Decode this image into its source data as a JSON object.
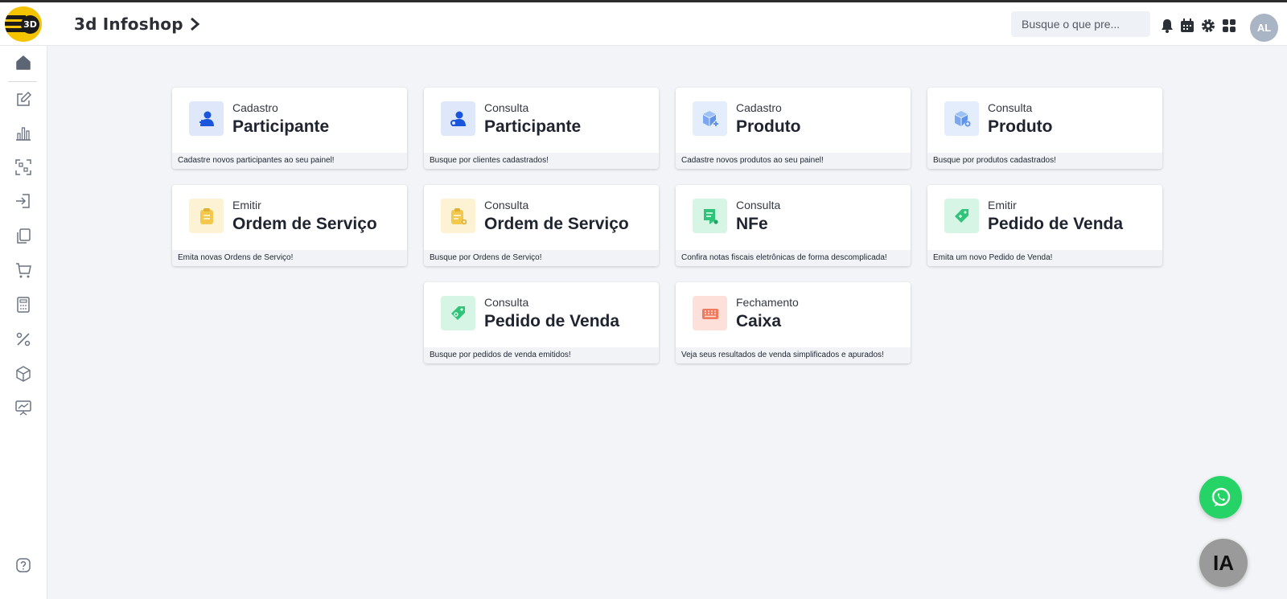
{
  "app": {
    "title": "3d Infoshop",
    "logo_text": "3D",
    "avatar_initials": "AL"
  },
  "search": {
    "placeholder": "Busque o que pre..."
  },
  "header_icons": [
    "bell-icon",
    "calendar-icon",
    "gear-icon",
    "apps-grid-icon"
  ],
  "sidebar": {
    "items": [
      "home-icon",
      "edit-icon",
      "chart-icon",
      "scan-icon",
      "login-icon",
      "copy-icon",
      "cart-icon",
      "calculator-icon",
      "percent-icon",
      "box-icon",
      "presentation-icon",
      "help-icon"
    ]
  },
  "cards": [
    {
      "sub": "Cadastro",
      "title": "Participante",
      "desc": "Cadastre novos participantes ao seu painel!",
      "icon": "user-add-icon",
      "color": "#1a56db",
      "bg": "#dfe7fb"
    },
    {
      "sub": "Consulta",
      "title": "Participante",
      "desc": "Busque por clientes cadastrados!",
      "icon": "user-search-icon",
      "color": "#1a56db",
      "bg": "#dfe7fb"
    },
    {
      "sub": "Cadastro",
      "title": "Produto",
      "desc": "Cadastre novos produtos ao seu painel!",
      "icon": "cube-add-icon",
      "color": "#7aa7f0",
      "bg": "#e3edfc"
    },
    {
      "sub": "Consulta",
      "title": "Produto",
      "desc": "Busque por produtos cadastrados!",
      "icon": "cube-search-icon",
      "color": "#7aa7f0",
      "bg": "#e3edfc"
    },
    {
      "sub": "Emitir",
      "title": "Ordem de Serviço",
      "desc": "Emita novas Ordens de Serviço!",
      "icon": "clipboard-icon",
      "color": "#f2c94c",
      "bg": "#fdf2d3"
    },
    {
      "sub": "Consulta",
      "title": "Ordem de Serviço",
      "desc": "Busque por Ordens de Serviço!",
      "icon": "clipboard-search-icon",
      "color": "#f2c94c",
      "bg": "#fdf2d3"
    },
    {
      "sub": "Consulta",
      "title": "NFe",
      "desc": "Confira notas fiscais eletrônicas de forma descomplicada!",
      "icon": "invoice-icon",
      "color": "#2fc47a",
      "bg": "#d6f5e4"
    },
    {
      "sub": "Emitir",
      "title": "Pedido de Venda",
      "desc": "Emita um novo Pedido de Venda!",
      "icon": "tag-add-icon",
      "color": "#2fc47a",
      "bg": "#d6f5e4"
    },
    {
      "sub": "Consulta",
      "title": "Pedido de Venda",
      "desc": "Busque por pedidos de venda emitidos!",
      "icon": "tag-search-icon",
      "color": "#2fc47a",
      "bg": "#d6f5e4"
    },
    {
      "sub": "Fechamento",
      "title": "Caixa",
      "desc": "Veja seus resultados de venda simplificados e apurados!",
      "icon": "cash-register-icon",
      "color": "#f07a5e",
      "bg": "#fde0d9"
    }
  ],
  "floating": {
    "ia_label": "IA",
    "whatsapp": "whatsapp-icon"
  }
}
